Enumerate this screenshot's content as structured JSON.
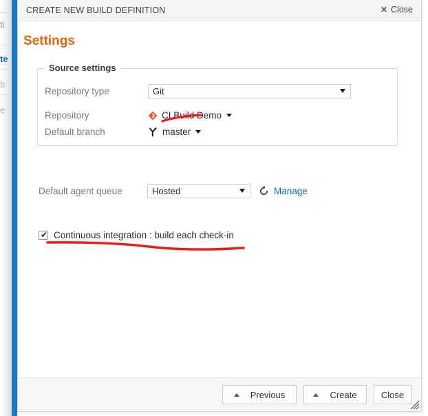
{
  "background": {
    "fragments": [
      "ti",
      "te",
      "b",
      "e"
    ]
  },
  "dialog": {
    "title": "CREATE NEW BUILD DEFINITION",
    "close_header_label": "Close",
    "close_header_icon": "close-x-icon",
    "heading": "Settings"
  },
  "source_settings": {
    "legend": "Source settings",
    "repository_type": {
      "label": "Repository type",
      "value": "Git",
      "caret_icon": "chevron-down-icon"
    },
    "repository": {
      "label": "Repository",
      "value": "CI Build Demo",
      "icon": "git-repository-diamond-icon",
      "icon_color": "#f2552c",
      "caret_icon": "chevron-down-icon"
    },
    "default_branch": {
      "label": "Default branch",
      "value": "master",
      "icon": "branch-icon",
      "icon_color": "#1f1f1f",
      "caret_icon": "chevron-down-icon"
    }
  },
  "agent_queue": {
    "label": "Default agent queue",
    "value": "Hosted",
    "caret_icon": "chevron-down-icon",
    "refresh_icon": "refresh-icon",
    "manage_link": "Manage",
    "link_color": "#1068b6"
  },
  "continuous_integration": {
    "label": "Continuous integration : build each check-in",
    "checked": true,
    "check_glyph": "✔"
  },
  "annotations": {
    "color": "#ee1b1b",
    "items": [
      {
        "name": "underline-repository-type"
      },
      {
        "name": "underline-continuous-integration"
      }
    ]
  },
  "footer": {
    "previous_label": "Previous",
    "create_label": "Create",
    "close_label": "Close",
    "chevron_icon": "chevron-up-icon"
  },
  "colors": {
    "heading_orange": "#e8600a",
    "accent_blue": "#1a7ac7",
    "annotation_red": "#ee1b1b"
  }
}
